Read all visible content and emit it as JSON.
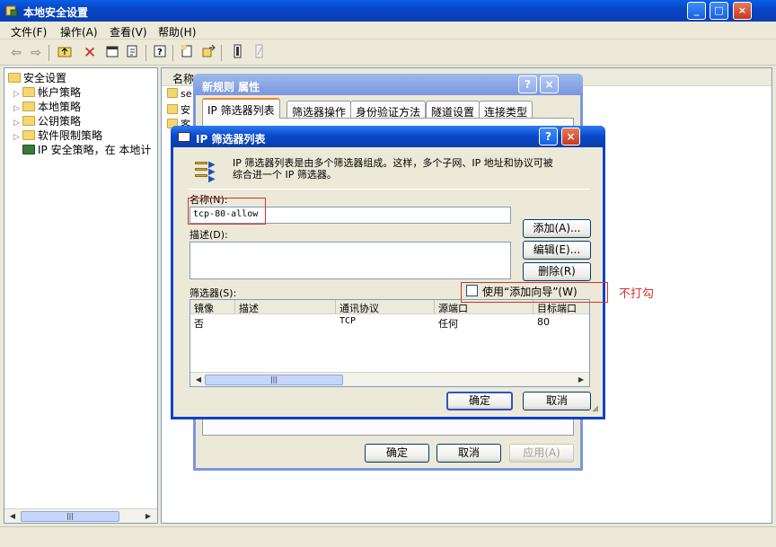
{
  "app": {
    "title": "本地安全设置",
    "window_buttons": [
      "_",
      "□",
      "×"
    ]
  },
  "menu": {
    "items": [
      "文件(F)",
      "操作(A)",
      "查看(V)",
      "帮助(H)"
    ]
  },
  "toolbar": {
    "icons": [
      "back-icon",
      "forward-icon",
      "up-folder-icon",
      "delete-icon",
      "properties-icon",
      "export-icon",
      "help-icon",
      "add-policy-icon",
      "assign-icon",
      "new-filter-icon",
      "new-action-icon"
    ]
  },
  "tree": {
    "root": "安全设置",
    "items": [
      "帐户策略",
      "本地策略",
      "公钥策略",
      "软件限制策略",
      "IP 安全策略，在 本地计"
    ]
  },
  "list": {
    "col_name": "名称",
    "rows": [
      "se",
      "安",
      "客"
    ]
  },
  "rule_dialog": {
    "title": "新规则 属性",
    "help": "?",
    "close": "×",
    "tabs": [
      "IP 筛选器列表",
      "筛选器操作",
      "身份验证方法",
      "隧道设置",
      "连接类型"
    ],
    "ok": "确定",
    "cancel": "取消",
    "apply": "应用(A)"
  },
  "filter_dialog": {
    "title": "IP 筛选器列表",
    "help": "?",
    "close": "×",
    "intro_line1": "IP 筛选器列表是由多个筛选器组成。这样，多个子网、IP 地址和协议可被",
    "intro_line2": "综合进一个 IP 筛选器。",
    "name_label": "名称(N):",
    "name_value": "tcp-80-allow",
    "desc_label": "描述(D):",
    "desc_value": "",
    "add_button": "添加(A)...",
    "edit_button": "编辑(E)...",
    "remove_button": "删除(R)",
    "filters_label": "筛选器(S):",
    "wizard_label": "使用“添加向导”(W)",
    "wizard_checked": false,
    "columns": [
      "镜像",
      "描述",
      "通讯协议",
      "源端口",
      "目标端口"
    ],
    "rows": [
      {
        "mirror": "否",
        "desc": "",
        "protocol": "TCP",
        "src_port": "任何",
        "dst_port": "80"
      }
    ],
    "ok": "确定",
    "cancel": "取消"
  },
  "annotation": {
    "text": "不打勾",
    "color": "#d8322a"
  }
}
